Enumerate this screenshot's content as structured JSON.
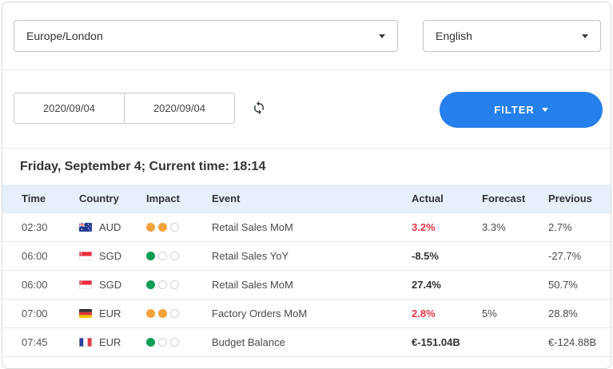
{
  "colors": {
    "accent_blue": "#2680eb",
    "negative_red": "#e8364a",
    "impact_medium": "#f2a33c",
    "impact_low": "#0f9d58",
    "table_header_bg": "#e7f0fa"
  },
  "toolbar": {
    "timezone": "Europe/London",
    "language": "English",
    "date_from": "2020/09/04",
    "date_to": "2020/09/04",
    "filter_label": "FILTER"
  },
  "heading": "Friday, September 4; Current time: 18:14",
  "table": {
    "columns": [
      "Time",
      "Country",
      "Impact",
      "Event",
      "Actual",
      "Forecast",
      "Previous"
    ],
    "rows": [
      {
        "time": "02:30",
        "country": "AUD",
        "flag": "australia",
        "impact": {
          "filled": 2,
          "level": "medium"
        },
        "event": "Retail Sales MoM",
        "actual": "3.2%",
        "actual_style": "negative",
        "forecast": "3.3%",
        "previous": "2.7%"
      },
      {
        "time": "06:00",
        "country": "SGD",
        "flag": "singapore",
        "impact": {
          "filled": 1,
          "level": "low"
        },
        "event": "Retail Sales YoY",
        "actual": "-8.5%",
        "actual_style": "neutral",
        "forecast": "",
        "previous": "-27.7%"
      },
      {
        "time": "06:00",
        "country": "SGD",
        "flag": "singapore",
        "impact": {
          "filled": 1,
          "level": "low"
        },
        "event": "Retail Sales MoM",
        "actual": "27.4%",
        "actual_style": "neutral",
        "forecast": "",
        "previous": "50.7%"
      },
      {
        "time": "07:00",
        "country": "EUR",
        "flag": "germany",
        "impact": {
          "filled": 2,
          "level": "medium"
        },
        "event": "Factory Orders MoM",
        "actual": "2.8%",
        "actual_style": "negative",
        "forecast": "5%",
        "previous": "28.8%"
      },
      {
        "time": "07:45",
        "country": "EUR",
        "flag": "france",
        "impact": {
          "filled": 1,
          "level": "low"
        },
        "event": "Budget Balance",
        "actual": "€-151.04B",
        "actual_style": "neutral",
        "forecast": "",
        "previous": "€-124.88B"
      }
    ]
  }
}
